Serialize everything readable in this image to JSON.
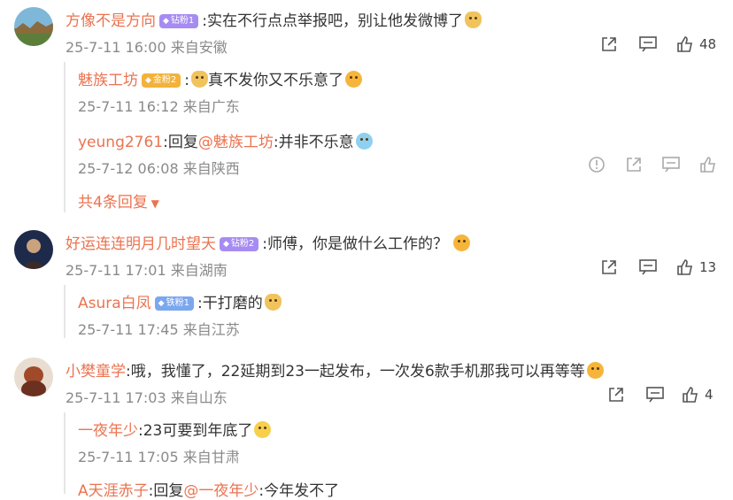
{
  "comments": [
    {
      "user": "方像不是方向",
      "badge": "钻粉1",
      "text": ":实在不行点点举报吧，别让他发微博了",
      "meta": "25-7-11 16:00 来自安徽",
      "likes": "48",
      "replies": [
        {
          "user": "魅族工坊",
          "badge": "金粉2",
          "text": "真不发你又不乐意了",
          "meta": "25-7-11 16:12 来自广东"
        },
        {
          "user": "yeung2761",
          "text_prefix": ":回复",
          "mention": "@魅族工坊",
          "text": ":并非不乐意",
          "meta": "25-7-12 06:08 来自陕西"
        }
      ],
      "more": "共4条回复"
    },
    {
      "user": "好运连连明月几时望天",
      "badge": "钻粉2",
      "text": ":师傅，你是做什么工作的？",
      "meta": "25-7-11 17:01 来自湖南",
      "likes": "13",
      "replies": [
        {
          "user": "Asura白凤",
          "badge": "铁粉1",
          "text": ":干打磨的",
          "meta": "25-7-11 17:45 来自江苏"
        }
      ]
    },
    {
      "user": "小樊童学",
      "text": ":哦，我懂了，22延期到23一起发布，一次发6款手机那我可以再等等",
      "meta": "25-7-11 17:03 来自山东",
      "likes": "4",
      "replies": [
        {
          "user": "一夜年少",
          "text": ":23可要到年底了",
          "meta": "25-7-11 17:05 来自甘肃"
        },
        {
          "user": "A天涯赤子",
          "text_prefix": ":回复",
          "mention": "@一夜年少",
          "text": ":今年发不了"
        }
      ]
    }
  ],
  "colors": {
    "username": "#eb7350",
    "meta": "#8a8a8a",
    "badge_purple": "#a68cf2",
    "badge_gold": "#f3b23a",
    "badge_blue": "#7ba7ee"
  },
  "icons": [
    "share-icon",
    "comment-icon",
    "thumbs-up-icon",
    "report-icon",
    "chevron-down-icon"
  ]
}
